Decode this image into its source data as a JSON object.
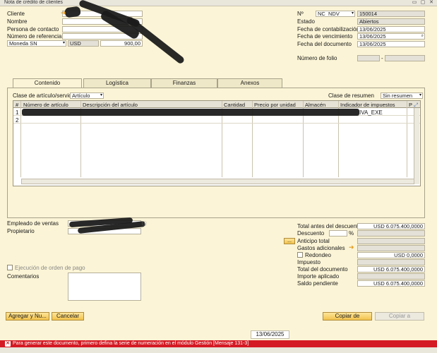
{
  "window": {
    "title": "Nota de crédito de clientes",
    "controls": [
      "▭",
      "▢",
      "✕"
    ]
  },
  "header_left": {
    "cliente_label": "Cliente",
    "nombre_label": "Nombre",
    "persona_label": "Persona de contacto",
    "referencia_label": "Número de referencia c",
    "moneda_value": "Moneda SN",
    "currency": "USD",
    "amount": "900,00"
  },
  "header_right": {
    "no_label": "Nº",
    "series_value": "NC_NDV",
    "doc_number": "150014",
    "estado_label": "Estado",
    "estado_value": "Abiertos",
    "fecha_contab_label": "Fecha de contabilización",
    "fecha_contab_value": "13/06/2025",
    "fecha_venc_label": "Fecha de vencimiento",
    "fecha_venc_value": "13/06/2025",
    "fecha_doc_label": "Fecha del documento",
    "fecha_doc_value": "13/06/2025",
    "folio_label": "Número de folio",
    "folio_sep": "-"
  },
  "tabs": [
    "Contenido",
    "Logística",
    "Finanzas",
    "Anexos"
  ],
  "content": {
    "clase_label": "Clase de artículo/servicio",
    "clase_value": "Artículo",
    "resumen_label": "Clase de resumen",
    "resumen_value": "Sin resumen",
    "columns": [
      "#",
      "Número de artículo",
      "Descripción del artículo",
      "Cantidad",
      "Precio por unidad",
      "Almacén",
      "Indicador de impuestos",
      "P"
    ],
    "rows": [
      {
        "num": "1",
        "tax": "IVA_EXE"
      },
      {
        "num": "2",
        "tax": ""
      }
    ]
  },
  "footer_left": {
    "empleado_label": "Empleado de ventas",
    "propietario_label": "Propietario",
    "ejecucion_label": "Ejecución de orden de pago",
    "comentarios_label": "Comentarios"
  },
  "totals": {
    "total_antes_label": "Total antes del descuento",
    "total_antes_value": "USD 6.075.400,0000",
    "descuento_label": "Descuento",
    "percent": "%",
    "anticipo_label": "Anticipo total",
    "gastos_label": "Gastos adicionales",
    "redondeo_label": "Redondeo",
    "redondeo_value": "USD 0,0000",
    "impuesto_label": "Impuesto",
    "total_doc_label": "Total del documento",
    "total_doc_value": "USD 6.075.400,0000",
    "importe_label": "Importe aplicado",
    "saldo_label": "Saldo pendiente",
    "saldo_value": "USD 6.075.400,0000",
    "ellipsis": "..."
  },
  "buttons": {
    "agregar": "Agregar y Nu...",
    "cancelar": "Cancelar",
    "copiar_de": "Copiar de",
    "copiar_a": "Copiar a"
  },
  "status": {
    "date": "13/06/2025",
    "message": "Para generar este documento, primero defina la serie de numeración en el módulo Gestión  [Mensaje 131-3]"
  }
}
